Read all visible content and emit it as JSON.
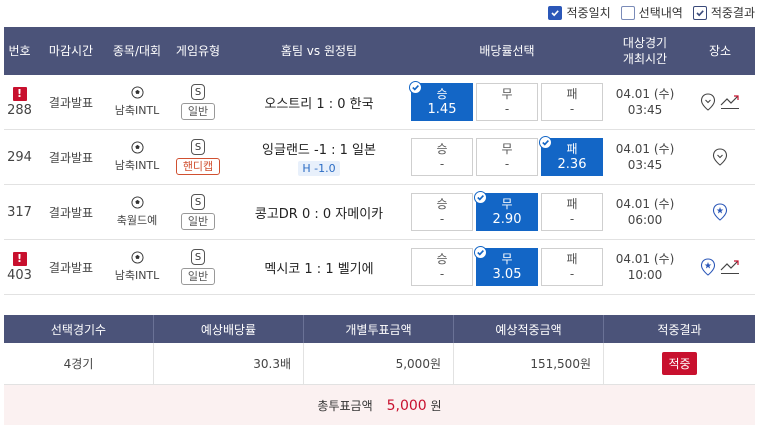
{
  "filters": [
    {
      "label": "적중일치",
      "state": "on"
    },
    {
      "label": "선택내역",
      "state": "off"
    },
    {
      "label": "적중결과",
      "state": "outline"
    }
  ],
  "headers": {
    "no": "번호",
    "close": "마감시간",
    "sport": "종목/대회",
    "type": "게임유형",
    "match": "홈팀 vs 원정팀",
    "odds": "배당률선택",
    "time_l1": "대상경기",
    "time_l2": "개최시간",
    "place": "장소"
  },
  "rows": [
    {
      "no": "288",
      "warn": true,
      "close": "결과발표",
      "sport": "남축INTL",
      "s": "S",
      "type": "일반",
      "hcap": false,
      "match": "오스트리 1 : 0 한국",
      "hline": "",
      "odds": [
        {
          "lbl": "승",
          "val": "1.45",
          "sel": true
        },
        {
          "lbl": "무",
          "val": "-",
          "sel": false
        },
        {
          "lbl": "패",
          "val": "-",
          "sel": false
        }
      ],
      "date": "04.01 (수)",
      "time": "03:45",
      "pin": "outline",
      "trend": true
    },
    {
      "no": "294",
      "warn": false,
      "close": "결과발표",
      "sport": "남축INTL",
      "s": "S",
      "type": "핸디캡",
      "hcap": true,
      "match": "잉글랜드 -1 : 1 일본",
      "hline": "H -1.0",
      "odds": [
        {
          "lbl": "승",
          "val": "-",
          "sel": false
        },
        {
          "lbl": "무",
          "val": "-",
          "sel": false
        },
        {
          "lbl": "패",
          "val": "2.36",
          "sel": true
        }
      ],
      "date": "04.01 (수)",
      "time": "03:45",
      "pin": "outline",
      "trend": false
    },
    {
      "no": "317",
      "warn": false,
      "close": "결과발표",
      "sport": "축월드예",
      "s": "S",
      "type": "일반",
      "hcap": false,
      "match": "콩고DR 0 : 0 자메이카",
      "hline": "",
      "odds": [
        {
          "lbl": "승",
          "val": "-",
          "sel": false
        },
        {
          "lbl": "무",
          "val": "2.90",
          "sel": true
        },
        {
          "lbl": "패",
          "val": "-",
          "sel": false
        }
      ],
      "date": "04.01 (수)",
      "time": "06:00",
      "pin": "star",
      "trend": false
    },
    {
      "no": "403",
      "warn": true,
      "close": "결과발표",
      "sport": "남축INTL",
      "s": "S",
      "type": "일반",
      "hcap": false,
      "match": "멕시코 1 : 1 벨기에",
      "hline": "",
      "odds": [
        {
          "lbl": "승",
          "val": "-",
          "sel": false
        },
        {
          "lbl": "무",
          "val": "3.05",
          "sel": true
        },
        {
          "lbl": "패",
          "val": "-",
          "sel": false
        }
      ],
      "date": "04.01 (수)",
      "time": "10:00",
      "pin": "star",
      "trend": true
    }
  ],
  "summary": {
    "headers": [
      "선택경기수",
      "예상배당률",
      "개별투표금액",
      "예상적중금액",
      "적중결과"
    ],
    "games": "4경기",
    "odds": "30.3배",
    "stake": "5,000원",
    "expected": "151,500원",
    "result": "적중",
    "total_label": "총투표금액",
    "total_amount": "5,000",
    "total_unit": "원"
  },
  "colors": {
    "header": "#4b5379",
    "selected": "#1366c6",
    "accent_red": "#c8102e"
  }
}
